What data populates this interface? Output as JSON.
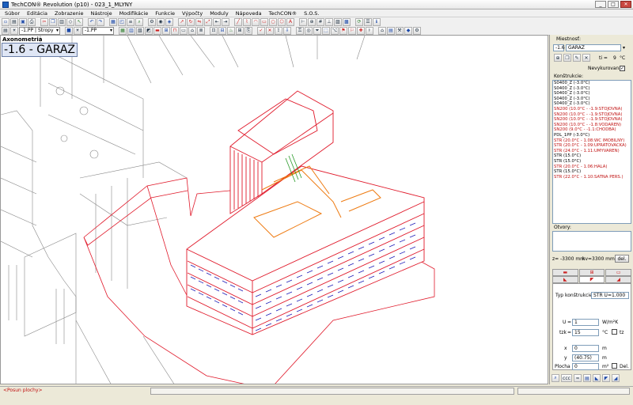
{
  "window": {
    "title": "TechCON® Revolution  (p10) - 023_1_MLYNY",
    "minimize": "_",
    "maximize": "□",
    "close": "✕"
  },
  "menu": [
    "Súbor",
    "Editácia",
    "Zobrazenie",
    "Nástroje",
    "Modifikácie",
    "Funkcie",
    "Výpočty",
    "Moduly",
    "Nápoveda",
    "TechCON®",
    "S.O.S."
  ],
  "toolbar2": {
    "layer_combo": "-1.PP | Stropy",
    "floor_combo": "-1.PP"
  },
  "canvas": {
    "view_name": "Axonometria",
    "layer_label": "-1.6 - GARAZ"
  },
  "panel": {
    "room_label": "Miestnosť:",
    "room_number": "-1.6",
    "room_name": "GARAZ",
    "temp_label": "ti =",
    "temp_value": "9",
    "temp_unit": "°C",
    "unheated_label": "Nevykurovaná",
    "unheated_checked": "✓",
    "constructions_label": "Konštrukcie:",
    "constructions": [
      {
        "t": "S0400_Z   (-3.0°C)",
        "c": "black"
      },
      {
        "t": "S0400_Z   (-3.0°C)",
        "c": "black"
      },
      {
        "t": "S0400_Z   (-3.0°C)",
        "c": "black"
      },
      {
        "t": "S0400_Z   (-3.0°C)",
        "c": "black"
      },
      {
        "t": "S0400_Z   (-3.0°C)",
        "c": "black"
      },
      {
        "t": "SN200   (10.0°C - -1.9:STOJOVNA)",
        "c": "red"
      },
      {
        "t": "SN200   (10.0°C - -1.9:STOJOVNA)",
        "c": "red"
      },
      {
        "t": "SN200   (10.0°C - -1.9:STOJOVNA)",
        "c": "red"
      },
      {
        "t": "SN200   (10.0°C - -1.8:VODAREN)",
        "c": "red"
      },
      {
        "t": "SN200   (9.0°C - -1.1:CHODBA)",
        "c": "red"
      },
      {
        "t": "PDL_1PP   (-3.0°C)",
        "c": "black"
      },
      {
        "t": "STR   (20.0°C - 1.08:WC IMOBILNY)",
        "c": "red"
      },
      {
        "t": "STR   (20.0°C - 1.09:UPRATOVACKA)",
        "c": "red"
      },
      {
        "t": "STR   (24.0°C - 1.11:UMYVAREN)",
        "c": "red"
      },
      {
        "t": "STR   (15.0°C)",
        "c": "black"
      },
      {
        "t": "STR   (15.0°C)",
        "c": "black"
      },
      {
        "t": "STR   (20.0°C - 1.06:HALA)",
        "c": "red"
      },
      {
        "t": "STR   (15.0°C)",
        "c": "black"
      },
      {
        "t": "STR   (22.0°C - 1.10:SATNA PERS.)",
        "c": "red"
      }
    ],
    "openings_label": "Otvory:",
    "z_label": "z=",
    "z_value": "-3300 mm",
    "kv_label": "kv=",
    "kv_value": "3300 mm",
    "del_button": "del.",
    "type_label": "Typ konštrukcie:",
    "type_value": "STR U=1.000",
    "u_label": "U",
    "u_value": "1",
    "u_unit": "W/m²K",
    "tzk_label": "tzk",
    "tzk_value": "15",
    "tzk_unit": "°C",
    "tz_label": "tz",
    "x_label": "x",
    "x_value": "0",
    "y_label": "y",
    "y_value": "(40.75)",
    "area_label": "Plocha",
    "area_value": "0",
    "m_unit": "m",
    "m2_unit": "m²",
    "del2_label": "Del.",
    "ccc_label": "ccc"
  },
  "status": {
    "message": "<Posun plochy>"
  },
  "colors": {
    "wall": "#e0192a",
    "window": "#1a1ab8",
    "highlight": "#ee7a10",
    "green": "#2a9a2a",
    "grid": "#808080"
  }
}
